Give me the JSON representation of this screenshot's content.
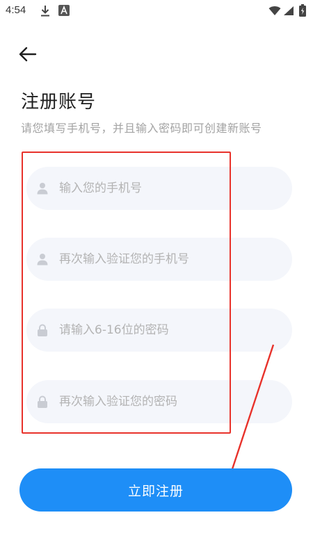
{
  "status_bar": {
    "time": "4:54",
    "icons": [
      "download-icon",
      "font-a-icon",
      "wifi-icon",
      "signal-icon",
      "battery-icon"
    ]
  },
  "header": {
    "back_icon": "back-arrow-icon",
    "title": "注册账号",
    "subtitle": "请您填写手机号，并且输入密码即可创建新账号"
  },
  "form": {
    "phone": {
      "placeholder": "输入您的手机号",
      "icon": "user-icon"
    },
    "phone_confirm": {
      "placeholder": "再次输入验证您的手机号",
      "icon": "user-icon"
    },
    "password": {
      "placeholder": "请输入6-16位的密码",
      "icon": "lock-icon"
    },
    "password_confirm": {
      "placeholder": "再次输入验证您的密码",
      "icon": "lock-icon"
    }
  },
  "submit_label": "立即注册",
  "colors": {
    "accent": "#1e8ef7",
    "field_bg": "#f4f6fb",
    "annotation": "#e8322b"
  }
}
